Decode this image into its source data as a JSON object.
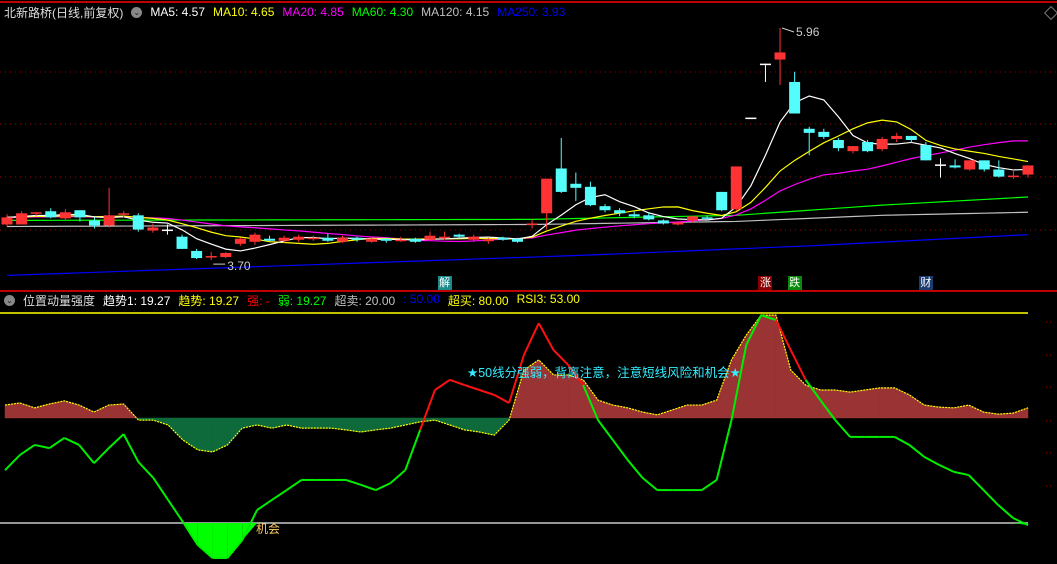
{
  "main_legend": {
    "title": "北新路桥(日线,前复权)",
    "items": [
      {
        "label": "MA5: 4.57",
        "color": "#ffffff"
      },
      {
        "label": "MA10: 4.65",
        "color": "#ffff00"
      },
      {
        "label": "MA20: 4.85",
        "color": "#ff00ff"
      },
      {
        "label": "MA60: 4.30",
        "color": "#00ff00"
      },
      {
        "label": "MA120: 4.15",
        "color": "#c0c0c0"
      },
      {
        "label": "MA250: 3.93",
        "color": "#0000ff"
      }
    ]
  },
  "ind_legend": {
    "title": "位置动量强度",
    "items": [
      {
        "label": "趋势1: 19.27",
        "color": "#ffffff"
      },
      {
        "label": "趋势: 19.27",
        "color": "#ffff00"
      },
      {
        "label": "强: -",
        "color": "#ff0000"
      },
      {
        "label": "弱: 19.27",
        "color": "#00ff00"
      },
      {
        "label": "超卖: 20.00",
        "color": "#c0c0c0"
      },
      {
        "label": ": 50.00",
        "color": "#0000ff"
      },
      {
        "label": "超买: 80.00",
        "color": "#ffff00"
      },
      {
        "label": "RSI3: 53.00",
        "color": "#ffff00"
      }
    ]
  },
  "price_high_label": "5.96",
  "price_low_label": "3.70",
  "event_tags": [
    {
      "text": "解",
      "color": "#1a8a8a",
      "index": 30
    },
    {
      "text": "涨",
      "color": "#8a0000",
      "index": 52
    },
    {
      "text": "跌",
      "color": "#0a8a0a",
      "index": 54
    },
    {
      "text": "财",
      "color": "#1a3c6e",
      "index": 63
    }
  ],
  "note": "★50线分强弱，背离注意，注意短线风险和机会★",
  "chance_label": "机会",
  "colors": {
    "up": "#ff3333",
    "down": "#54fcfc",
    "doji": "#ffffff"
  },
  "chart_data": {
    "type": "candlestick",
    "candles": [
      [
        4.03,
        4.13,
        4.01,
        4.1
      ],
      [
        4.03,
        4.16,
        4.03,
        4.14
      ],
      [
        4.14,
        4.15,
        4.11,
        4.15
      ],
      [
        4.16,
        4.19,
        4.09,
        4.1
      ],
      [
        4.09,
        4.18,
        4.07,
        4.15
      ],
      [
        4.17,
        4.17,
        4.06,
        4.1
      ],
      [
        4.07,
        4.1,
        3.99,
        4.02
      ],
      [
        4.02,
        4.39,
        4.0,
        4.12
      ],
      [
        4.13,
        4.16,
        4.1,
        4.14
      ],
      [
        4.12,
        4.14,
        3.96,
        3.98
      ],
      [
        3.97,
        4.04,
        3.95,
        4.0
      ],
      [
        3.98,
        4.03,
        3.93,
        3.98,
        "w"
      ],
      [
        3.91,
        3.93,
        3.79,
        3.79
      ],
      [
        3.77,
        3.79,
        3.69,
        3.7
      ],
      [
        3.72,
        3.76,
        3.68,
        3.72
      ],
      [
        3.71,
        3.76,
        3.7,
        3.75
      ],
      [
        3.84,
        3.9,
        3.82,
        3.89
      ],
      [
        3.86,
        3.95,
        3.83,
        3.93
      ],
      [
        3.89,
        3.92,
        3.86,
        3.87
      ],
      [
        3.87,
        3.92,
        3.85,
        3.9
      ],
      [
        3.88,
        3.93,
        3.86,
        3.91
      ],
      [
        3.89,
        3.92,
        3.87,
        3.9
      ],
      [
        3.9,
        3.94,
        3.86,
        3.87
      ],
      [
        3.86,
        3.92,
        3.85,
        3.9
      ],
      [
        3.9,
        3.91,
        3.86,
        3.88
      ],
      [
        3.86,
        3.9,
        3.85,
        3.89
      ],
      [
        3.89,
        3.9,
        3.85,
        3.87
      ],
      [
        3.88,
        3.91,
        3.86,
        3.88
      ],
      [
        3.89,
        3.9,
        3.85,
        3.86
      ],
      [
        3.88,
        3.96,
        3.87,
        3.92
      ],
      [
        3.91,
        3.96,
        3.88,
        3.91
      ],
      [
        3.93,
        3.94,
        3.89,
        3.91
      ],
      [
        3.88,
        3.93,
        3.86,
        3.91
      ],
      [
        3.88,
        3.9,
        3.84,
        3.88
      ],
      [
        3.9,
        3.91,
        3.87,
        3.88
      ],
      [
        3.89,
        3.9,
        3.85,
        3.86
      ],
      [
        4.03,
        4.08,
        3.99,
        4.04
      ],
      [
        4.14,
        4.48,
        3.98,
        4.48
      ],
      [
        4.58,
        4.88,
        4.34,
        4.35
      ],
      [
        4.43,
        4.54,
        4.26,
        4.39
      ],
      [
        4.4,
        4.45,
        4.21,
        4.22
      ],
      [
        4.21,
        4.23,
        4.15,
        4.17
      ],
      [
        4.17,
        4.19,
        4.11,
        4.14
      ],
      [
        4.13,
        4.16,
        4.09,
        4.11
      ],
      [
        4.12,
        4.15,
        4.07,
        4.08
      ],
      [
        4.07,
        4.08,
        4.03,
        4.04
      ],
      [
        4.03,
        4.06,
        4.02,
        4.05
      ],
      [
        4.07,
        4.11,
        4.05,
        4.11
      ],
      [
        4.1,
        4.12,
        4.07,
        4.09
      ],
      [
        4.35,
        4.35,
        4.16,
        4.17
      ],
      [
        4.18,
        4.6,
        4.16,
        4.6
      ],
      [
        5.08,
        5.08,
        5.08,
        5.08,
        "w"
      ],
      [
        5.61,
        5.61,
        5.43,
        5.61,
        "w"
      ],
      [
        5.65,
        5.96,
        5.4,
        5.72
      ],
      [
        5.43,
        5.53,
        5.12,
        5.12
      ],
      [
        4.97,
        4.99,
        4.71,
        4.93
      ],
      [
        4.94,
        4.97,
        4.87,
        4.89
      ],
      [
        4.86,
        4.88,
        4.75,
        4.78
      ],
      [
        4.75,
        4.8,
        4.73,
        4.8
      ],
      [
        4.84,
        4.86,
        4.74,
        4.75
      ],
      [
        4.77,
        4.89,
        4.75,
        4.87
      ],
      [
        4.87,
        4.93,
        4.84,
        4.9
      ],
      [
        4.9,
        4.9,
        4.83,
        4.86
      ],
      [
        4.81,
        4.84,
        4.66,
        4.66
      ],
      [
        4.62,
        4.68,
        4.49,
        4.62,
        "w"
      ],
      [
        4.61,
        4.67,
        4.58,
        4.59
      ],
      [
        4.57,
        4.66,
        4.56,
        4.66
      ],
      [
        4.66,
        4.66,
        4.55,
        4.57
      ],
      [
        4.57,
        4.66,
        4.49,
        4.5
      ],
      [
        4.51,
        4.57,
        4.48,
        4.51
      ],
      [
        4.52,
        4.61,
        4.49,
        4.61
      ]
    ],
    "ma_long": {
      "ma60": [
        [
          0,
          4.07
        ],
        [
          36,
          4.08
        ],
        [
          50,
          4.12
        ],
        [
          60,
          4.22
        ],
        [
          70,
          4.3
        ]
      ],
      "ma120": [
        [
          0,
          4.01
        ],
        [
          36,
          4.03
        ],
        [
          50,
          4.06
        ],
        [
          60,
          4.12
        ],
        [
          70,
          4.15
        ]
      ],
      "ma250": [
        [
          0,
          3.53
        ],
        [
          20,
          3.63
        ],
        [
          40,
          3.73
        ],
        [
          55,
          3.82
        ],
        [
          70,
          3.93
        ]
      ]
    },
    "price_range": [
      3.53,
      6.23
    ],
    "indicator": {
      "range": [
        0,
        100
      ],
      "levels": [
        20,
        50,
        80
      ],
      "line": [
        35.1,
        39.4,
        42.3,
        41.4,
        44.3,
        42.3,
        37.1,
        41.4,
        45.4,
        37.4,
        32.9,
        26.6,
        20.3,
        13.7,
        10.0,
        10.0,
        15.1,
        23.7,
        26.6,
        29.4,
        32.3,
        32.3,
        32.3,
        32.3,
        30.9,
        29.4,
        31.4,
        35.1,
        46.6,
        58.0,
        60.9,
        59.4,
        58.0,
        56.6,
        54.3,
        68.0,
        77.1,
        69.4,
        65.1,
        59.4,
        49.4,
        43.7,
        38.0,
        32.9,
        29.4,
        29.4,
        29.4,
        29.4,
        32.3,
        49.4,
        70.9,
        79.4,
        78.0,
        69.4,
        60.9,
        55.1,
        49.4,
        44.6,
        44.6,
        44.6,
        44.6,
        42.3,
        38.9,
        36.6,
        34.6,
        33.7,
        29.4,
        25.1,
        21.4,
        19.4
      ],
      "area": [
        53.7,
        54.3,
        52.9,
        54.0,
        54.9,
        53.7,
        51.7,
        53.7,
        54.0,
        49.4,
        49.4,
        48.0,
        43.7,
        40.9,
        40.3,
        42.3,
        47.1,
        48.0,
        47.1,
        48.0,
        47.1,
        47.1,
        47.1,
        46.6,
        46.0,
        46.6,
        47.1,
        48.0,
        48.9,
        49.4,
        48.0,
        46.6,
        46.0,
        45.1,
        49.4,
        63.7,
        66.6,
        62.3,
        62.3,
        60.9,
        55.1,
        53.7,
        52.9,
        51.7,
        50.9,
        52.3,
        53.7,
        53.7,
        55.1,
        66.6,
        73.7,
        79.4,
        79.4,
        63.7,
        59.4,
        58.0,
        58.0,
        57.4,
        58.0,
        58.6,
        58.6,
        56.6,
        53.7,
        53.1,
        52.9,
        53.7,
        51.7,
        51.1,
        51.4,
        52.9
      ]
    }
  }
}
